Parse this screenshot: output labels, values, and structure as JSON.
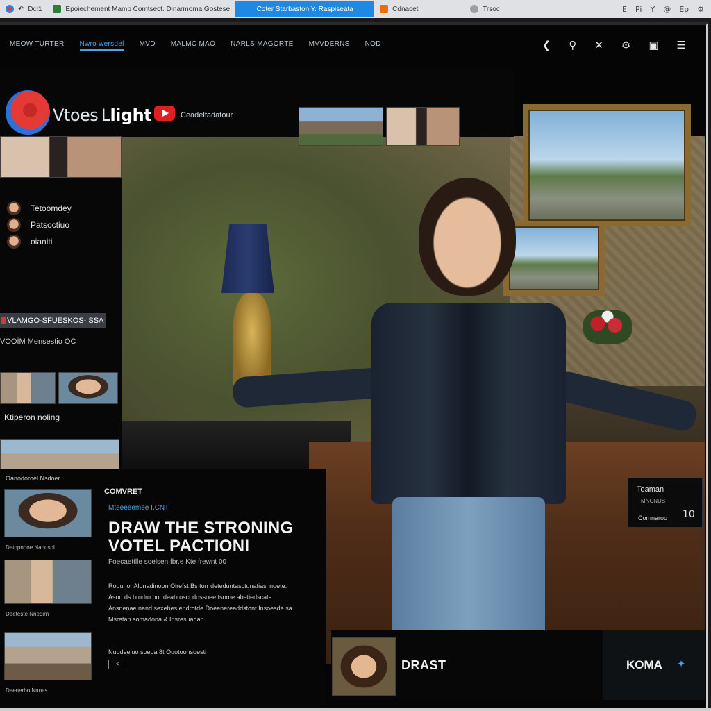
{
  "browser": {
    "tabs": [
      {
        "label": "Epoiechement Mamp Comtsect. Dinarmoma Gostese",
        "color": "#2e7d32"
      },
      {
        "label": "Coter Starbaston Y. Raspiseata",
        "color": "#1565c0",
        "active": true
      },
      {
        "label": "Cdnacet",
        "color": "#ef6c00"
      },
      {
        "label": "Trsoc",
        "color": "#757575"
      }
    ],
    "left_ids": "Dcl1",
    "toolbar_icons": [
      "E",
      "Pi",
      "Y",
      "@",
      "Ep",
      "⚙"
    ]
  },
  "nav": {
    "links": [
      "MEOW TURTER",
      "Nwro wersdel",
      "MVD",
      "MALMC MAO",
      "NARLS MAGORTE",
      "MVVDERNS",
      "NOD"
    ],
    "active_index": 1
  },
  "nav_icons": [
    "chevron-left-icon",
    "search-icon",
    "close-icon",
    "gear-icon",
    "window-icon",
    "menu-icon"
  ],
  "brand": {
    "name_a": "Vtoes L",
    "name_b": "light",
    "channel": "Ceadelfadatour"
  },
  "sidebar": {
    "items": [
      {
        "label": "Tetoomdey"
      },
      {
        "label": "Patsoctiuo"
      },
      {
        "label": "oianiti"
      }
    ],
    "banner": "VLAMGO-SFUESKOS- SSA",
    "subline": "VOOİM Mensestio OC",
    "section_title": "Ktiperon noling"
  },
  "article": {
    "kicker": "Oanodoroel Nsdoer",
    "label": "COMVRET",
    "meta": "Mteeeeemee I.CNT",
    "title": "DRAW THE STRONING VOTEL  PACTIONI",
    "byline": "Foecaettlle soelsen  fbr.e  Kte  frewnt 00",
    "body": "Rodunor Alonadinoon Olrefst  Bs  torr deteduntasctunatiasi noete. Asod  ds  brodro  bor  deabrosct dossoee  tsome  abetiedscats Ansnenae  nend  sexehes  endrotde  Doeenereaddstont  Insoesde sa Msretan somadona  &  Insresuadan",
    "footer": "Nuodeeiuo soeoa  8t  Ouotoonsoesti",
    "button": "<",
    "captions": [
      "Detopnnoe Nanosol",
      "Deeteste Nnedirn",
      "Deenerbo Nnoes"
    ]
  },
  "infocard": {
    "title": "Toaman",
    "sub": "MNCNUS",
    "action": "Comnaroo",
    "count": "10"
  },
  "bottom": {
    "name": "DRAST",
    "brand": "KOMA"
  }
}
